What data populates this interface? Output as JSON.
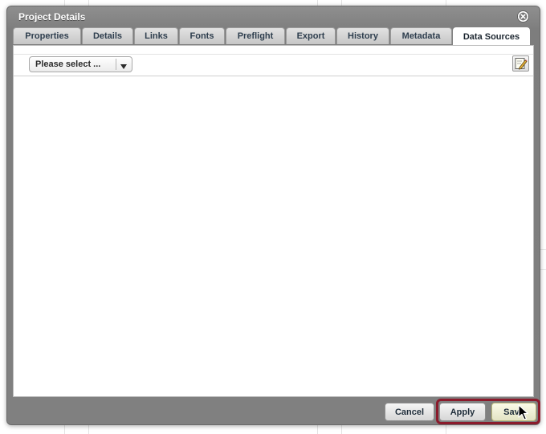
{
  "dialog": {
    "title": "Project Details",
    "close_icon": "close-circle-icon"
  },
  "tabs": [
    {
      "label": "Properties",
      "active": false
    },
    {
      "label": "Details",
      "active": false
    },
    {
      "label": "Links",
      "active": false
    },
    {
      "label": "Fonts",
      "active": false
    },
    {
      "label": "Preflight",
      "active": false
    },
    {
      "label": "Export",
      "active": false
    },
    {
      "label": "History",
      "active": false
    },
    {
      "label": "Metadata",
      "active": false
    },
    {
      "label": "Data Sources",
      "active": true
    }
  ],
  "panel": {
    "select_value": "Please select ...",
    "edit_icon": "edit-pencil-icon"
  },
  "footer": {
    "cancel_label": "Cancel",
    "apply_label": "Apply",
    "save_label": "Save"
  },
  "colors": {
    "dialog_frame": "#808080",
    "highlight_border": "#8b1a2b",
    "tab_text": "#2e3e4e"
  }
}
